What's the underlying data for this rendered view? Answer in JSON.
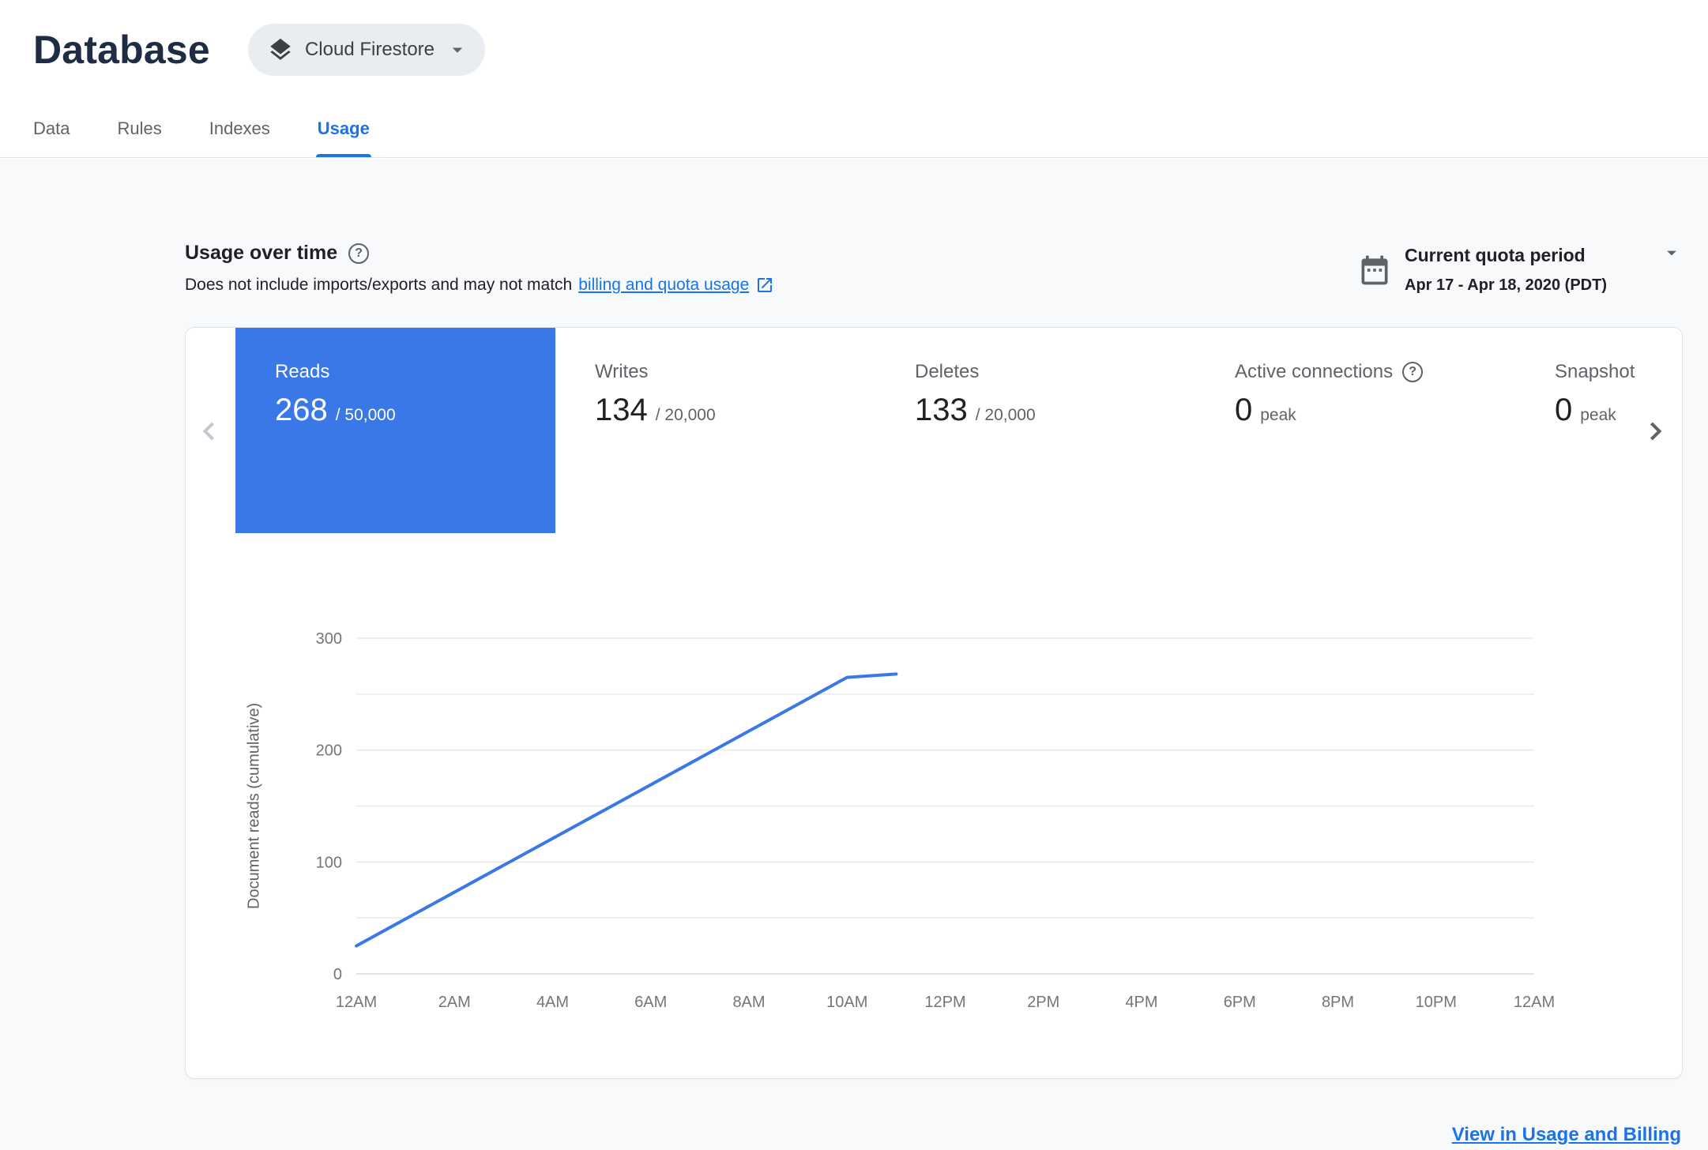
{
  "colors": {
    "accent": "#1a73e8",
    "selected_card": "#3b78e7",
    "chart_line": "#3b78e7"
  },
  "header": {
    "title": "Database",
    "product_selector": {
      "label": "Cloud Firestore",
      "icon": "firestore-layers-icon",
      "caret_icon": "chevron-down-icon"
    }
  },
  "tabs": [
    {
      "label": "Data",
      "active": false
    },
    {
      "label": "Rules",
      "active": false
    },
    {
      "label": "Indexes",
      "active": false
    },
    {
      "label": "Usage",
      "active": true
    }
  ],
  "usage_section": {
    "title": "Usage over time",
    "help_icon": "help-circle-icon",
    "subtitle_prefix": "Does not include imports/exports and may not match",
    "subtitle_link": "billing and quota usage",
    "subtitle_link_icon": "external-link-icon",
    "quota_period": {
      "icon": "calendar-icon",
      "label": "Current quota period",
      "caret_icon": "chevron-down-icon",
      "range": "Apr 17 - Apr 18, 2020 (PDT)"
    }
  },
  "metrics": [
    {
      "label": "Reads",
      "value": "268",
      "suffix": "/ 50,000",
      "selected": true
    },
    {
      "label": "Writes",
      "value": "134",
      "suffix": "/ 20,000",
      "selected": false
    },
    {
      "label": "Deletes",
      "value": "133",
      "suffix": "/ 20,000",
      "selected": false
    },
    {
      "label": "Active connections",
      "value": "0",
      "suffix": "peak",
      "selected": false,
      "help_icon": "help-circle-icon"
    },
    {
      "label": "Snapshot listeners",
      "value": "0",
      "suffix": "peak",
      "selected": false,
      "truncated": true
    }
  ],
  "carousel": {
    "left_icon": "chevron-left-icon",
    "right_icon": "chevron-right-icon"
  },
  "chart_data": {
    "type": "line",
    "title": "",
    "xlabel": "",
    "ylabel": "Document reads (cumulative)",
    "x_ticks": [
      "12AM",
      "2AM",
      "4AM",
      "6AM",
      "8AM",
      "10AM",
      "12PM",
      "2PM",
      "4PM",
      "6PM",
      "8PM",
      "10PM",
      "12AM"
    ],
    "y_ticks": [
      0,
      100,
      200,
      300
    ],
    "ylim": [
      0,
      300
    ],
    "xlim_hours": [
      0,
      24
    ],
    "gridline_step": 50,
    "grid": true,
    "legend": "none",
    "series": [
      {
        "name": "Document reads (cumulative)",
        "color": "#3b78e7",
        "points": [
          {
            "hour": 0,
            "value": 25
          },
          {
            "hour": 10,
            "value": 265
          },
          {
            "hour": 11,
            "value": 268
          }
        ]
      }
    ]
  },
  "footer": {
    "view_billing_link": "View in Usage and Billing"
  }
}
